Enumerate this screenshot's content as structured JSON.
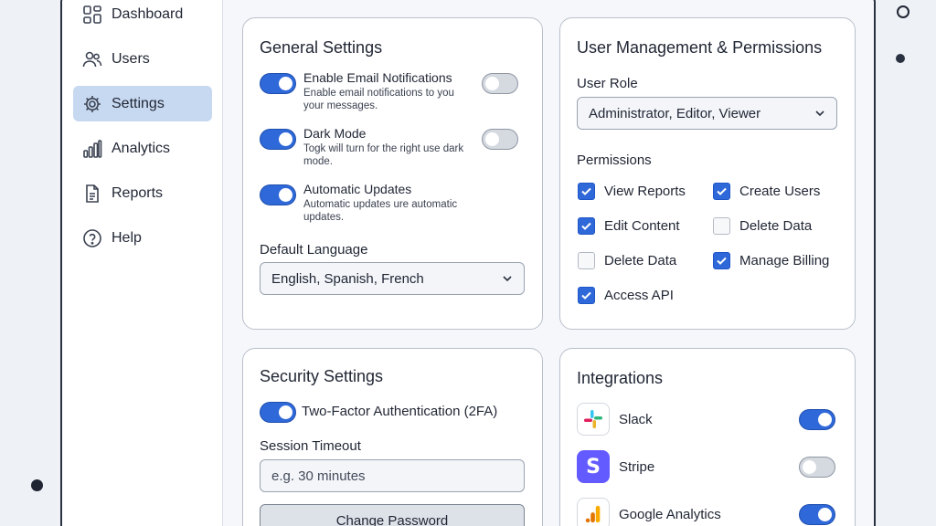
{
  "sidebar": {
    "items": [
      {
        "label": "Dashboard",
        "icon": "dashboard-icon",
        "active": false
      },
      {
        "label": "Users",
        "icon": "users-icon",
        "active": false
      },
      {
        "label": "Settings",
        "icon": "gear-icon",
        "active": true
      },
      {
        "label": "Analytics",
        "icon": "analytics-icon",
        "active": false
      },
      {
        "label": "Reports",
        "icon": "document-icon",
        "active": false
      },
      {
        "label": "Help",
        "icon": "help-icon",
        "active": false
      }
    ]
  },
  "general": {
    "title": "General Settings",
    "options": [
      {
        "title": "Enable Email Notifications",
        "desc": "Enable email notifications to you your messages.",
        "primary_on": true,
        "secondary_on": false
      },
      {
        "title": "Dark Mode",
        "desc": "Togk will turn for the right use dark mode.",
        "primary_on": true,
        "secondary_on": false
      },
      {
        "title": "Automatic Updates",
        "desc": "Automatic updates ure automatic updates.",
        "primary_on": true
      }
    ],
    "language_label": "Default Language",
    "language_value": "English, Spanish, French"
  },
  "users": {
    "title": "User Management & Permissions",
    "role_label": "User Role",
    "role_value": "Administrator, Editor, Viewer",
    "permissions_label": "Permissions",
    "permissions": [
      {
        "label": "View Reports",
        "checked": true
      },
      {
        "label": "Create Users",
        "checked": true
      },
      {
        "label": "Edit Content",
        "checked": true
      },
      {
        "label": "Delete Data",
        "checked": false
      },
      {
        "label": "Delete Data",
        "checked": false
      },
      {
        "label": "Manage Billing",
        "checked": true
      },
      {
        "label": "Access API",
        "checked": true
      }
    ]
  },
  "security": {
    "title": "Security Settings",
    "twofa_label": "Two-Factor Authentication (2FA)",
    "twofa_on": true,
    "timeout_label": "Session Timeout",
    "timeout_placeholder": "e.g. 30 minutes",
    "change_password_label": "Change Password"
  },
  "integrations": {
    "title": "Integrations",
    "items": [
      {
        "name": "Slack",
        "icon": "slack-icon",
        "enabled": true
      },
      {
        "name": "Stripe",
        "icon": "stripe-icon",
        "enabled": false
      },
      {
        "name": "Google Analytics",
        "icon": "google-analytics-icon",
        "enabled": true
      }
    ]
  },
  "colors": {
    "accent": "#2f68d8",
    "active_nav": "#c7d9f1",
    "stripe": "#635bff"
  }
}
